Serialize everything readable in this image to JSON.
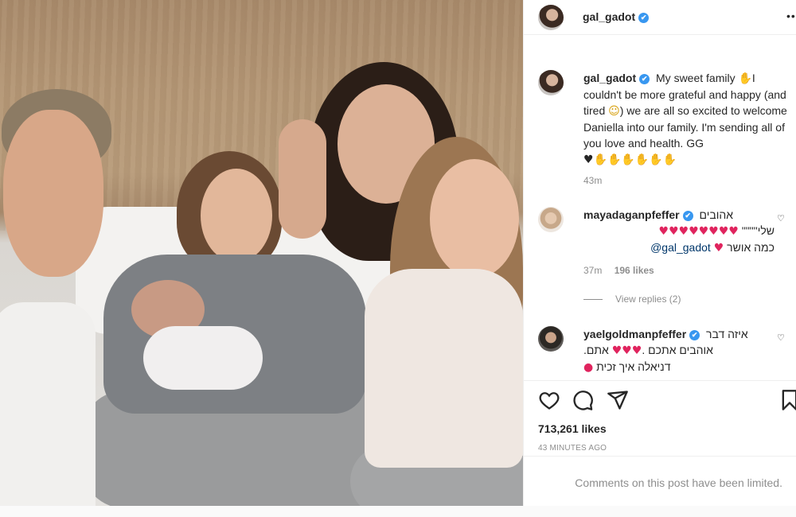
{
  "post": {
    "author": "gal_gadot",
    "verified_glyph": "✔",
    "more_glyph": "•••"
  },
  "caption": {
    "author": "gal_gadot",
    "text_part1": "My sweet family ",
    "hand_glyph": "✋",
    "text_part2": "I couldn't be more grateful and happy (and tired ",
    "face_glyph": "☺",
    "text_part3": ") we are all so excited to welcome Daniella into our family. I'm sending all of you love and health. GG ",
    "heart_glyph": "♥",
    "hands_row": "✋✋✋✋✋✋",
    "time": "43m"
  },
  "comments": [
    {
      "author": "mayadaganpfeffer",
      "text_line1": "אהובים",
      "text_line2_prefix": "שלי\"\"\"\" ",
      "hearts": "♥♥♥♥♥♥♥♥",
      "text_line3": "כמה אושר",
      "mention": "@gal_gadot",
      "time": "37m",
      "likes": "196 likes",
      "view_replies": "View replies (2)"
    },
    {
      "author": "yaelgoldmanpfeffer",
      "text_line1": "איזה דבר",
      "text_line2": "אתם.",
      "text_line2b": "אוהבים אתכם .",
      "text_line3": "דניאלה איך זכית",
      "lips_glyph": "💋"
    }
  ],
  "actions": {
    "likes": "713,261 likes",
    "posted": "43 MINUTES AGO"
  },
  "footer": {
    "limited": "Comments on this post have been limited."
  },
  "colors": {
    "verified": "#3897f0",
    "mention": "#00376b",
    "muted": "#8e8e8e",
    "heart": "#e0245e"
  }
}
